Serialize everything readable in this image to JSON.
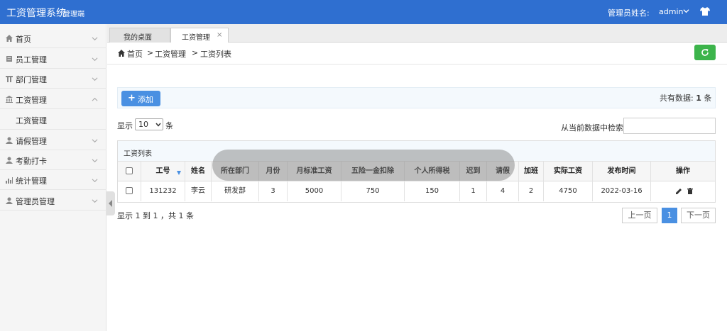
{
  "header": {
    "app_title": "工资管理系统",
    "app_subtitle": "管理端",
    "admin_label": "管理员姓名:",
    "admin_name": "admin"
  },
  "sidebar": {
    "items": [
      {
        "label": "首页",
        "icon": "home-icon"
      },
      {
        "label": "员工管理",
        "icon": "employee-icon"
      },
      {
        "label": "部门管理",
        "icon": "department-icon"
      },
      {
        "label": "工资管理",
        "icon": "salary-icon"
      },
      {
        "label": "工资管理",
        "icon": ""
      },
      {
        "label": "请假管理",
        "icon": "leave-icon"
      },
      {
        "label": "考勤打卡",
        "icon": "attendance-icon"
      },
      {
        "label": "统计管理",
        "icon": "stats-icon"
      },
      {
        "label": "管理员管理",
        "icon": "admin-icon"
      }
    ]
  },
  "tabs": [
    {
      "label": "我的桌面"
    },
    {
      "label": "工资管理",
      "close": "×"
    }
  ],
  "breadcrumb": {
    "home": "首页",
    "sep": ">",
    "level1": "工资管理",
    "level2": "工资列表"
  },
  "toolbar": {
    "add_label": "添加",
    "total_prefix": "共有数据:",
    "total_count": "1",
    "total_suffix": "条"
  },
  "list_controls": {
    "show_label": "显示",
    "page_size": "10",
    "page_size_unit": "条",
    "search_label": "从当前数据中检索:",
    "search_value": ""
  },
  "table": {
    "caption": "工资列表",
    "columns": [
      "工号",
      "姓名",
      "所在部门",
      "月份",
      "月标准工资",
      "五险一金扣除",
      "个人所得税",
      "迟到",
      "请假",
      "加班",
      "实际工资",
      "发布时间",
      "操作"
    ],
    "rows": [
      [
        "131232",
        "李云",
        "研发部",
        "3",
        "5000",
        "750",
        "150",
        "1",
        "4",
        "2",
        "4750",
        "2022-03-16"
      ]
    ]
  },
  "pagination": {
    "summary": "显示 1 到 1 ，共 1 条",
    "prev": "上一页",
    "current": "1",
    "next": "下一页"
  },
  "colors": {
    "header_blue": "#2f6fd0",
    "add_button": "#4a90e2",
    "refresh_button": "#3cb44b"
  }
}
